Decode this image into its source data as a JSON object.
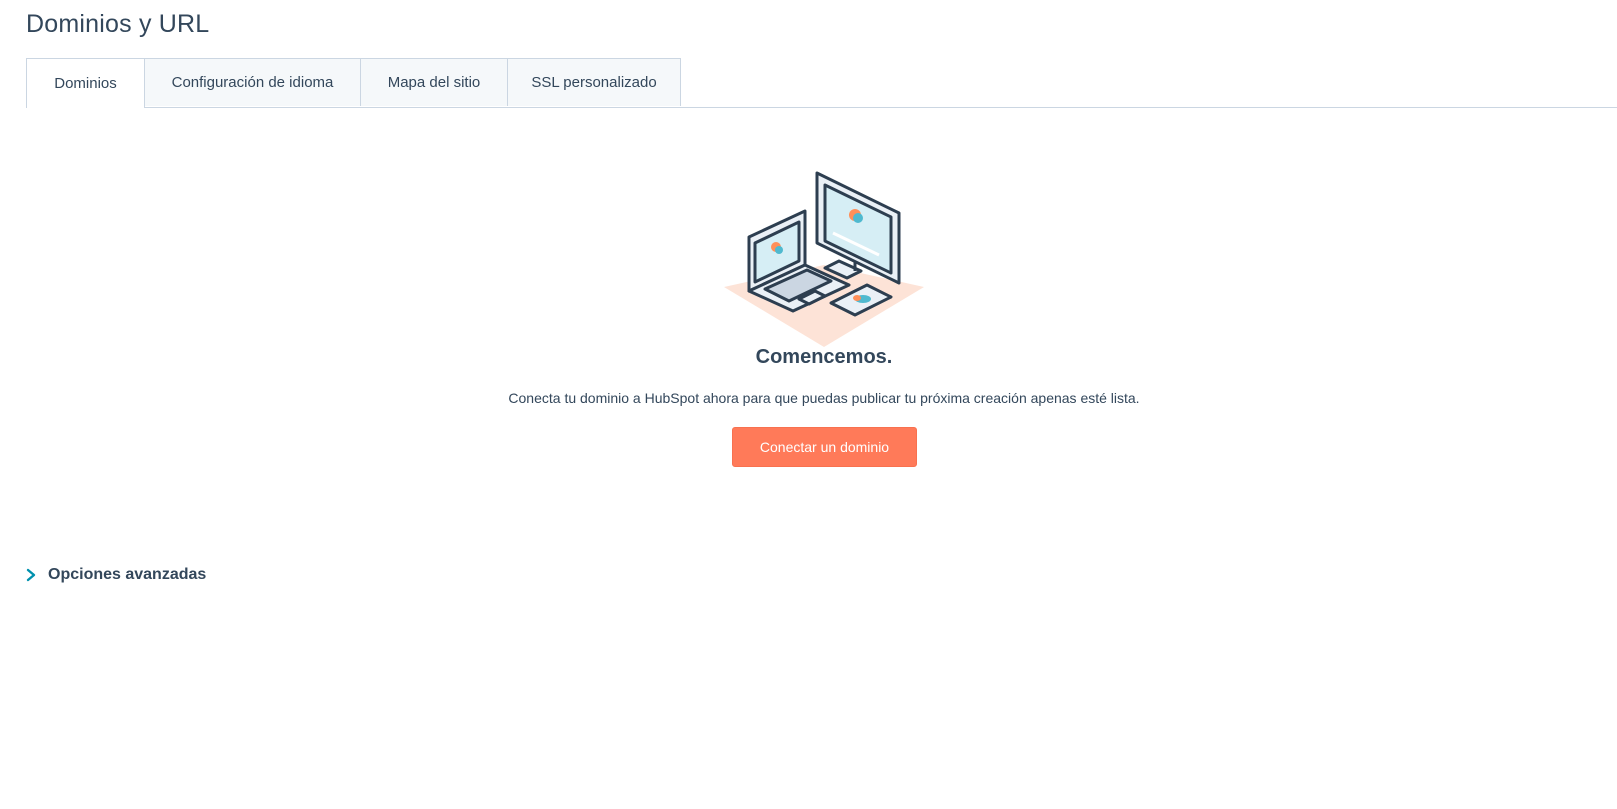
{
  "page": {
    "title": "Dominios y URL"
  },
  "tabs": [
    {
      "label": "Dominios",
      "active": true
    },
    {
      "label": "Configuración de idioma",
      "active": false
    },
    {
      "label": "Mapa del sitio",
      "active": false
    },
    {
      "label": "SSL personalizado",
      "active": false
    }
  ],
  "empty_state": {
    "illustration_icon": "devices-illustration-icon",
    "title": "Comencemos.",
    "description": "Conecta tu dominio a HubSpot ahora para que puedas publicar tu próxima creación apenas esté lista.",
    "cta_label": "Conectar un dominio"
  },
  "advanced": {
    "icon": "chevron-right-icon",
    "label": "Opciones avanzadas"
  },
  "colors": {
    "accent": "#ff7a59",
    "text": "#33475b",
    "border": "#cbd6e2",
    "tab_bg": "#f5f8fa",
    "chevron": "#0091ae"
  }
}
